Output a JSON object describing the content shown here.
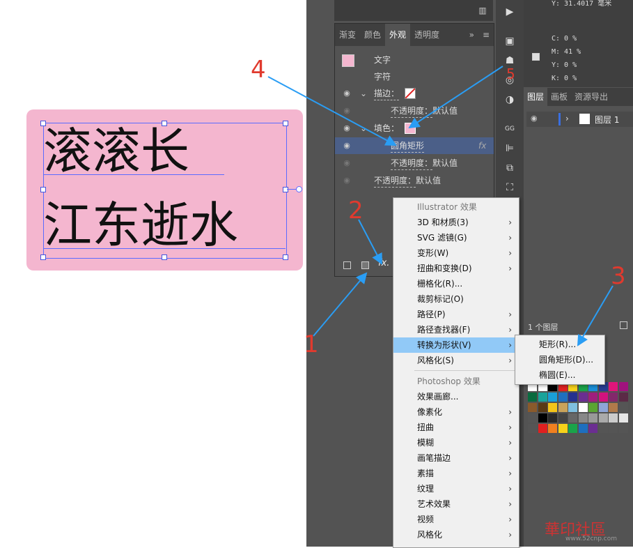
{
  "canvas": {
    "line1": "滚滚长",
    "line2": "江东逝水"
  },
  "appearance_panel": {
    "tabs": [
      "渐变",
      "颜色",
      "外观",
      "透明度"
    ],
    "active_tab": "外观",
    "tab_more": "»",
    "tab_menu": "≡",
    "rows": {
      "text": "文字",
      "characters": "字符",
      "stroke_label": "描边：",
      "stroke_opacity_label": "不透明度：",
      "stroke_opacity_value": "默认值",
      "fill_label": "填色：",
      "effect_name": "圆角矩形",
      "effect_fx": "fx",
      "fill_opacity_label": "不透明度：",
      "fill_opacity_value": "默认值",
      "object_opacity_label": "不透明度：",
      "object_opacity_value": "默认值"
    },
    "footer_fx": "fx."
  },
  "cmyk": {
    "top_partial": "Y: 31.4017 毫米",
    "c": "C: 0 %",
    "m": "M: 41 %",
    "y": "Y: 0 %",
    "k": "K: 0 %"
  },
  "layers_panel": {
    "tabs": [
      "图层",
      "画板",
      "资源导出"
    ],
    "layer_name": "图层 1",
    "layer_count": "1 个图层"
  },
  "effects_menu": {
    "illustrator_header": "Illustrator 效果",
    "illustrator_items": [
      {
        "label": "3D 和材质(3)",
        "sub": true
      },
      {
        "label": "SVG 滤镜(G)",
        "sub": true
      },
      {
        "label": "变形(W)",
        "sub": true
      },
      {
        "label": "扭曲和变换(D)",
        "sub": true
      },
      {
        "label": "栅格化(R)...",
        "sub": false
      },
      {
        "label": "裁剪标记(O)",
        "sub": false
      },
      {
        "label": "路径(P)",
        "sub": true
      },
      {
        "label": "路径查找器(F)",
        "sub": true
      },
      {
        "label": "转换为形状(V)",
        "sub": true
      },
      {
        "label": "风格化(S)",
        "sub": true
      }
    ],
    "photoshop_header": "Photoshop 效果",
    "photoshop_items": [
      {
        "label": "效果画廊...",
        "sub": false
      },
      {
        "label": "像素化",
        "sub": true
      },
      {
        "label": "扭曲",
        "sub": true
      },
      {
        "label": "模糊",
        "sub": true
      },
      {
        "label": "画笔描边",
        "sub": true
      },
      {
        "label": "素描",
        "sub": true
      },
      {
        "label": "纹理",
        "sub": true
      },
      {
        "label": "艺术效果",
        "sub": true
      },
      {
        "label": "视频",
        "sub": true
      },
      {
        "label": "风格化",
        "sub": true
      }
    ],
    "highlighted": "转换为形状(V)"
  },
  "shape_submenu": {
    "items": [
      "矩形(R)...",
      "圆角矩形(D)...",
      "椭圆(E)..."
    ]
  },
  "annotations": [
    "1",
    "2",
    "3",
    "4",
    "5"
  ],
  "watermark": "華印社區",
  "watermark_url": "www.52cnp.com",
  "colors": {
    "pink_fill": "#f4b6cf",
    "panel_bg": "#535353",
    "selection_blue": "#4b5f88",
    "menu_highlight": "#91c9f7",
    "annotation_red": "#e03a2e",
    "arrow_blue": "#2a9df4"
  }
}
